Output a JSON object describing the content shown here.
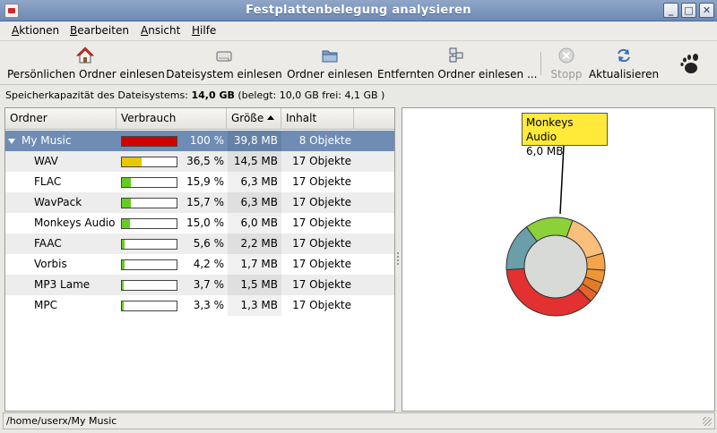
{
  "window": {
    "title": "Festplattenbelegung analysieren"
  },
  "menu": [
    {
      "mnemonic": "A",
      "rest": "ktionen"
    },
    {
      "mnemonic": "B",
      "rest": "earbeiten"
    },
    {
      "mnemonic": "A",
      "rest": "nsicht"
    },
    {
      "mnemonic": "H",
      "rest": "ilfe"
    }
  ],
  "toolbar": {
    "home_label": "Persönlichen Ordner einlesen",
    "filesystem_label": "Dateisystem einlesen",
    "folder_label": "Ordner einlesen",
    "remote_label": "Entfernten Ordner einlesen ...",
    "stop_label": "Stopp",
    "refresh_label": "Aktualisieren"
  },
  "info": {
    "prefix": "Speicherkapazität des Dateisystems:",
    "total": "14,0 GB",
    "suffix": "(belegt: 10,0 GB frei: 4,1 GB )"
  },
  "table": {
    "headers": {
      "folder": "Ordner",
      "usage": "Verbrauch",
      "size": "Größe",
      "contents": "Inhalt"
    },
    "rows": [
      {
        "name": "My Music",
        "percent": "100 %",
        "fraction": 1.0,
        "size": "39,8 MB",
        "contents": "8 Objekte",
        "bar_color": "#d00000"
      },
      {
        "name": "WAV",
        "percent": "36,5 %",
        "fraction": 0.365,
        "size": "14,5 MB",
        "contents": "17 Objekte",
        "bar_color": "#e6c800"
      },
      {
        "name": "FLAC",
        "percent": "15,9 %",
        "fraction": 0.159,
        "size": "6,3 MB",
        "contents": "17 Objekte",
        "bar_color": "#66cc22"
      },
      {
        "name": "WavPack",
        "percent": "15,7 %",
        "fraction": 0.157,
        "size": "6,3 MB",
        "contents": "17 Objekte",
        "bar_color": "#66cc22"
      },
      {
        "name": "Monkeys Audio",
        "percent": "15,0 %",
        "fraction": 0.15,
        "size": "6,0 MB",
        "contents": "17 Objekte",
        "bar_color": "#66cc22"
      },
      {
        "name": "FAAC",
        "percent": "5,6 %",
        "fraction": 0.056,
        "size": "2,2 MB",
        "contents": "17 Objekte",
        "bar_color": "#66cc22"
      },
      {
        "name": "Vorbis",
        "percent": "4,2 %",
        "fraction": 0.042,
        "size": "1,7 MB",
        "contents": "17 Objekte",
        "bar_color": "#66cc22"
      },
      {
        "name": "MP3 Lame",
        "percent": "3,7 %",
        "fraction": 0.037,
        "size": "1,5 MB",
        "contents": "17 Objekte",
        "bar_color": "#66cc22"
      },
      {
        "name": "MPC",
        "percent": "3,3 %",
        "fraction": 0.033,
        "size": "1,3 MB",
        "contents": "17 Objekte",
        "bar_color": "#66cc22"
      }
    ]
  },
  "ring_chart": {
    "tooltip_name": "Monkeys Audio",
    "tooltip_size": "6,0 MB",
    "segments": [
      {
        "name": "WAV",
        "fraction": 0.365,
        "color": "#e33030"
      },
      {
        "name": "FLAC",
        "fraction": 0.159,
        "color": "#6a9ea8"
      },
      {
        "name": "WavPack",
        "fraction": 0.157,
        "color": "#8cd13a"
      },
      {
        "name": "Monkeys Audio",
        "fraction": 0.15,
        "color": "#fbbf7c"
      },
      {
        "name": "FAAC",
        "fraction": 0.056,
        "color": "#f5a44c"
      },
      {
        "name": "Vorbis",
        "fraction": 0.042,
        "color": "#ef9635"
      },
      {
        "name": "MP3 Lame",
        "fraction": 0.037,
        "color": "#e57a25"
      },
      {
        "name": "MPC",
        "fraction": 0.033,
        "color": "#e8642a"
      }
    ]
  },
  "status": {
    "path": "/home/userx/My Music"
  }
}
